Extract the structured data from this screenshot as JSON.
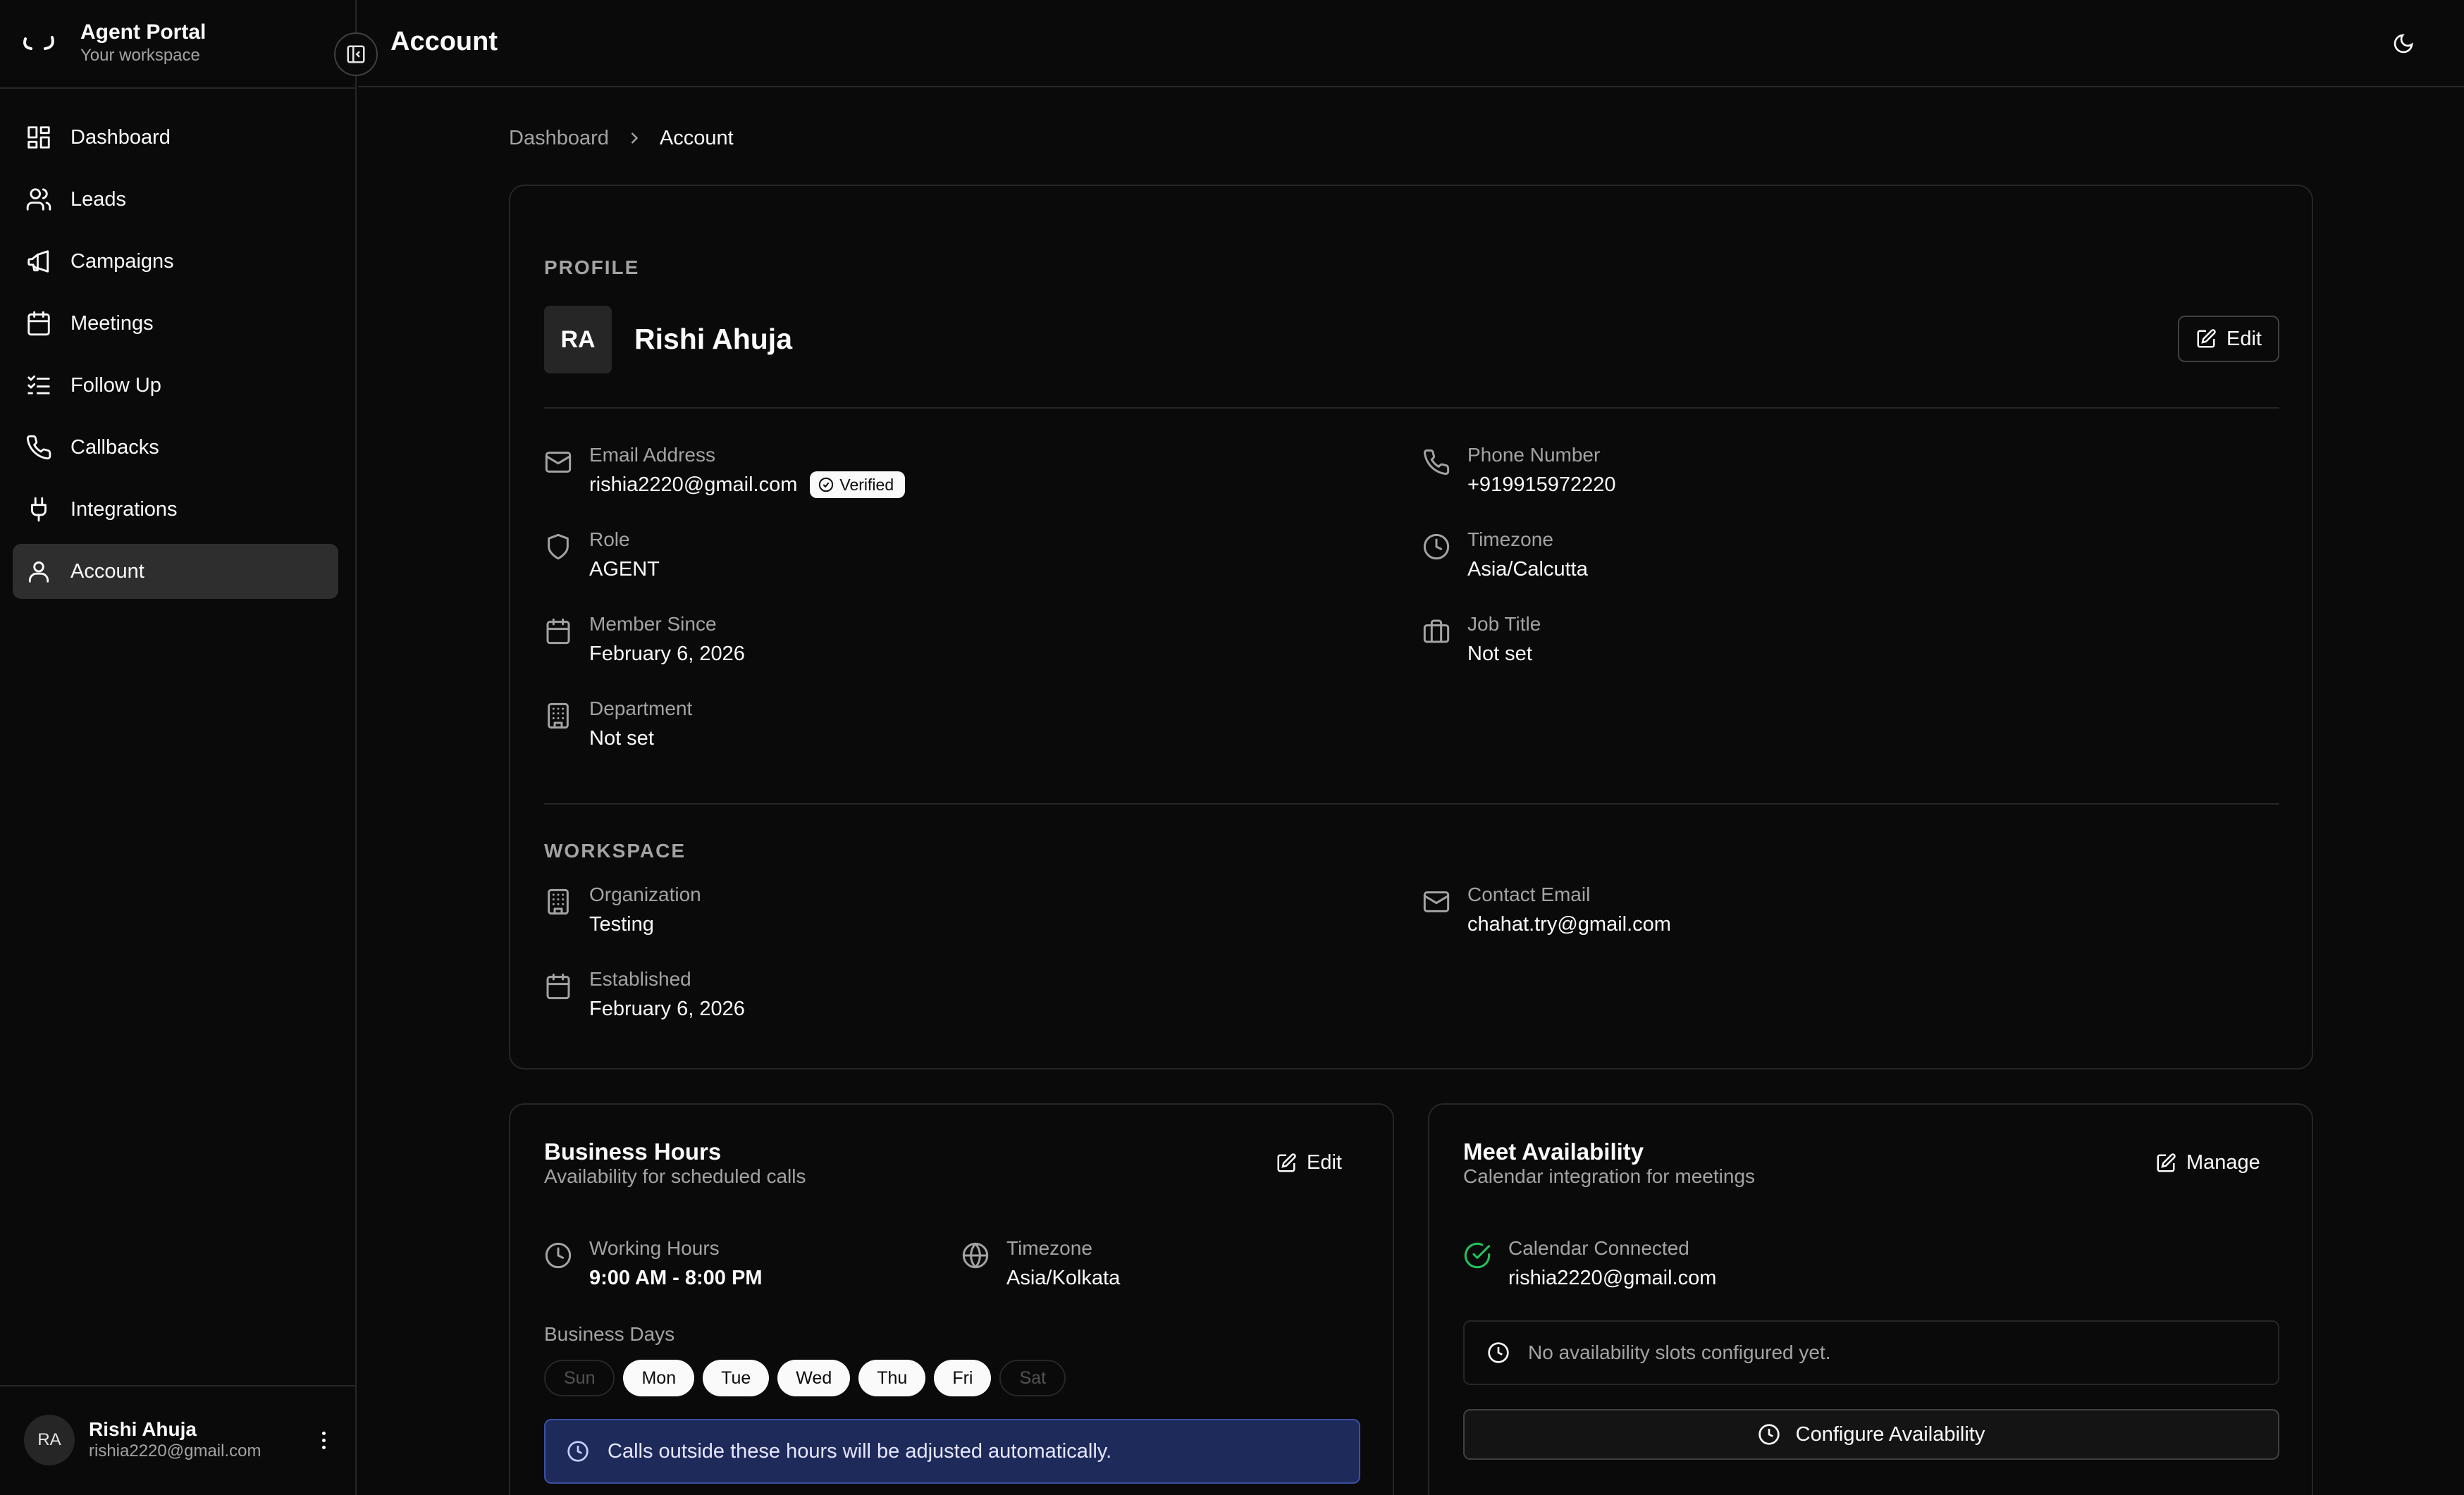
{
  "app": {
    "brand_title": "Agent Portal",
    "brand_subtitle": "Your workspace",
    "page_title": "Account"
  },
  "sidebar": {
    "items": [
      {
        "label": "Dashboard",
        "icon": "dashboard-grid-icon"
      },
      {
        "label": "Leads",
        "icon": "users-icon"
      },
      {
        "label": "Campaigns",
        "icon": "megaphone-icon"
      },
      {
        "label": "Meetings",
        "icon": "calendar-icon"
      },
      {
        "label": "Follow Up",
        "icon": "list-check-icon"
      },
      {
        "label": "Callbacks",
        "icon": "phone-icon"
      },
      {
        "label": "Integrations",
        "icon": "plug-icon"
      },
      {
        "label": "Account",
        "icon": "user-icon",
        "active": true
      }
    ],
    "user": {
      "initials": "RA",
      "name": "Rishi Ahuja",
      "email": "rishia2220@gmail.com"
    }
  },
  "breadcrumb": {
    "parent": "Dashboard",
    "current": "Account"
  },
  "profile": {
    "section_label": "PROFILE",
    "initials": "RA",
    "name": "Rishi Ahuja",
    "edit_label": "Edit",
    "fields": {
      "email": {
        "label": "Email Address",
        "value": "rishia2220@gmail.com",
        "badge": "Verified"
      },
      "phone": {
        "label": "Phone Number",
        "value": "+919915972220"
      },
      "role": {
        "label": "Role",
        "value": "AGENT"
      },
      "timezone": {
        "label": "Timezone",
        "value": "Asia/Calcutta"
      },
      "member_since": {
        "label": "Member Since",
        "value": "February 6, 2026"
      },
      "job_title": {
        "label": "Job Title",
        "value": "Not set"
      },
      "department": {
        "label": "Department",
        "value": "Not set"
      }
    }
  },
  "workspace": {
    "section_label": "WORKSPACE",
    "organization": {
      "label": "Organization",
      "value": "Testing"
    },
    "contact_email": {
      "label": "Contact Email",
      "value": "chahat.try@gmail.com"
    },
    "established": {
      "label": "Established",
      "value": "February 6, 2026"
    }
  },
  "business_hours": {
    "title": "Business Hours",
    "subtitle": "Availability for scheduled calls",
    "edit_label": "Edit",
    "working_hours": {
      "label": "Working Hours",
      "value": "9:00 AM - 8:00 PM"
    },
    "timezone": {
      "label": "Timezone",
      "value": "Asia/Kolkata"
    },
    "days_label": "Business Days",
    "days": [
      {
        "label": "Sun",
        "active": false
      },
      {
        "label": "Mon",
        "active": true
      },
      {
        "label": "Tue",
        "active": true
      },
      {
        "label": "Wed",
        "active": true
      },
      {
        "label": "Thu",
        "active": true
      },
      {
        "label": "Fri",
        "active": true
      },
      {
        "label": "Sat",
        "active": false
      }
    ],
    "notice": "Calls outside these hours will be adjusted automatically."
  },
  "meet_availability": {
    "title": "Meet Availability",
    "subtitle": "Calendar integration for meetings",
    "manage_label": "Manage",
    "calendar": {
      "label": "Calendar Connected",
      "value": "rishia2220@gmail.com"
    },
    "empty_slots": "No availability slots configured yet.",
    "configure_label": "Configure Availability"
  },
  "colors": {
    "background": "#0a0a0a",
    "border": "#262626",
    "active_nav": "#2e2e2e",
    "muted_text": "#a3a3a3",
    "notice_bg": "#1e2a5a",
    "success": "#22c55e"
  }
}
